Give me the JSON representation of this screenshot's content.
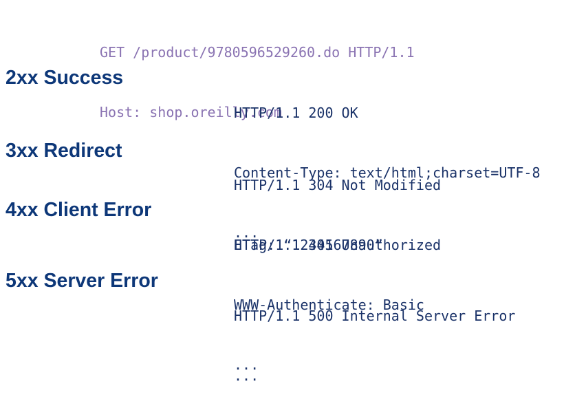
{
  "request": {
    "lines": [
      "GET /product/9780596529260.do HTTP/1.1",
      "Host: shop.oreilly.com"
    ]
  },
  "status_classes": [
    {
      "heading": "2xx Success",
      "response_lines": [
        "HTTP/1.1 200 OK",
        "Content-Type: text/html;charset=UTF-8",
        "..."
      ]
    },
    {
      "heading": "3xx Redirect",
      "response_lines": [
        "HTTP/1.1 304 Not Modified",
        "ETag: “1234567890”"
      ]
    },
    {
      "heading": "4xx Client Error",
      "response_lines": [
        "HTTP/1.1 401 Unauthorized",
        "WWW-Authenticate: Basic",
        "..."
      ]
    },
    {
      "heading": "5xx Server Error",
      "response_lines": [
        "HTTP/1.1 500 Internal Server Error",
        "..."
      ]
    }
  ],
  "colors": {
    "heading": "#0d3778",
    "response_text": "#1a3268",
    "request_text": "#8a73b2"
  }
}
